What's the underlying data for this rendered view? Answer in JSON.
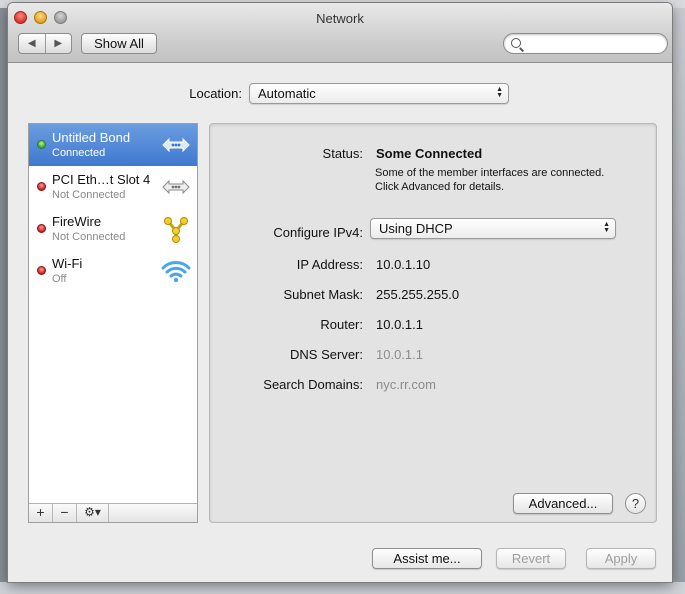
{
  "window": {
    "title": "Network"
  },
  "toolbar": {
    "back_glyph": "◀",
    "forward_glyph": "▶",
    "show_all_label": "Show All",
    "search_placeholder": ""
  },
  "location": {
    "label": "Location:",
    "value": "Automatic"
  },
  "services": [
    {
      "name": "Untitled Bond",
      "state": "Connected",
      "status_color": "green",
      "icon": "bond-arrows-icon",
      "selected": true
    },
    {
      "name": "PCI Eth…t Slot 4",
      "state": "Not Connected",
      "status_color": "red",
      "icon": "ethernet-arrows-icon",
      "selected": false
    },
    {
      "name": "FireWire",
      "state": "Not Connected",
      "status_color": "red",
      "icon": "firewire-icon",
      "selected": false
    },
    {
      "name": "Wi-Fi",
      "state": "Off",
      "status_color": "red",
      "icon": "wifi-icon",
      "selected": false
    }
  ],
  "sidebar_buttons": {
    "add": "+",
    "remove": "−",
    "gear": "⚙▾"
  },
  "detail": {
    "status_label": "Status:",
    "status_value": "Some Connected",
    "status_description": "Some of the member interfaces are connected. Click Advanced for details.",
    "configure_label": "Configure IPv4:",
    "configure_value": "Using DHCP",
    "ip_label": "IP Address:",
    "ip_value": "10.0.1.10",
    "subnet_label": "Subnet Mask:",
    "subnet_value": "255.255.255.0",
    "router_label": "Router:",
    "router_value": "10.0.1.1",
    "dns_label": "DNS Server:",
    "dns_value": "10.0.1.1",
    "search_domains_label": "Search Domains:",
    "search_domains_value": "nyc.rr.com",
    "advanced_label": "Advanced...",
    "help_label": "?"
  },
  "footer": {
    "assist_label": "Assist me...",
    "revert_label": "Revert",
    "apply_label": "Apply"
  },
  "colors": {
    "selection": "#3f78cf",
    "connected": "#3ea52a",
    "disconnected": "#d11e1e"
  }
}
